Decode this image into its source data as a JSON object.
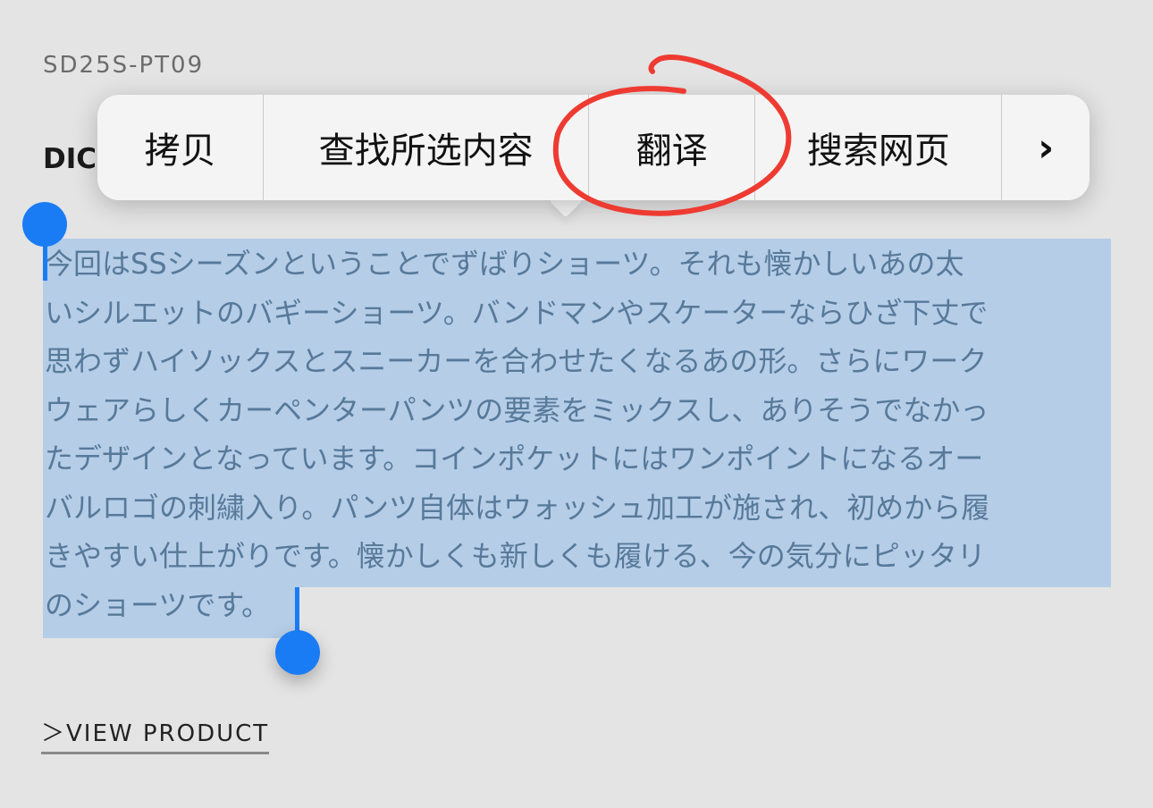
{
  "product": {
    "code": "SD25S-PT09",
    "title_visible": "DIC"
  },
  "description_lines": [
    "今回はSSシーズンということでずばりショーツ。それも懐かしいあの太",
    "いシルエットのバギーショーツ。バンドマンやスケーターならひざ下丈で",
    "思わずハイソックスとスニーカーを合わせたくなるあの形。さらにワーク",
    "ウェアらしくカーペンターパンツの要素をミックスし、ありそうでなかっ",
    "たデザインとなっています。コインポケットにはワンポイントになるオー",
    "バルロゴの刺繍入り。パンツ自体はウォッシュ加工が施され、初めから履",
    "きやすい仕上がりです。懐かしくも新しくも履ける、今の気分にピッタリ",
    "のショーツです。"
  ],
  "context_menu": {
    "copy": "拷贝",
    "find_selection": "查找所选内容",
    "translate": "翻译",
    "search_web": "搜索网页",
    "more_icon": "chevron-right-icon"
  },
  "link": {
    "view_product": "＞VIEW PRODUCT"
  },
  "colors": {
    "background": "#e4e4e4",
    "selection_highlight": "#b5cde7",
    "selection_handle": "#1a7cf5",
    "annotation_circle": "#ee3b32",
    "menu_background": "#f4f4f4"
  }
}
